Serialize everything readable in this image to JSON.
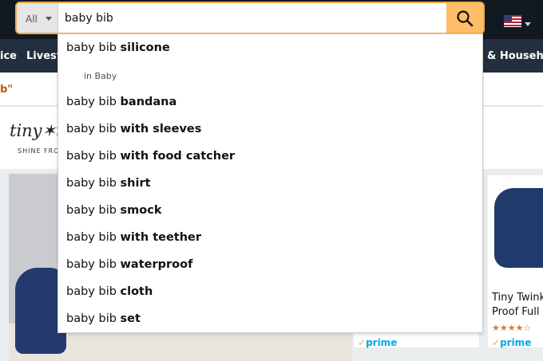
{
  "search": {
    "department": "All",
    "query": "baby bib"
  },
  "nav": {
    "items": [
      "ice",
      "Livestr",
      "& Househo"
    ]
  },
  "page": {
    "result_quote": "b\"",
    "brand_logo": "tiny✶t",
    "brand_tagline": "SHINE FROM",
    "cards": [
      {
        "title": "",
        "prime": "prime"
      },
      {
        "title": "Tiny Twink Proof Full",
        "stars": "★★★★☆",
        "prime": "prime"
      }
    ]
  },
  "suggestions": [
    {
      "prefix": "baby bib",
      "bold": "silicone",
      "sub": "in Baby"
    },
    {
      "prefix": "baby bib",
      "bold": "bandana"
    },
    {
      "prefix": "baby bib",
      "bold": "with sleeves"
    },
    {
      "prefix": "baby bib",
      "bold": "with food catcher"
    },
    {
      "prefix": "baby bib",
      "bold": "shirt"
    },
    {
      "prefix": "baby bib",
      "bold": "smock"
    },
    {
      "prefix": "baby bib",
      "bold": "with teether"
    },
    {
      "prefix": "baby bib",
      "bold": "waterproof"
    },
    {
      "prefix": "baby bib",
      "bold": "cloth"
    },
    {
      "prefix": "baby bib",
      "bold": "set"
    }
  ],
  "colors": {
    "header": "#131921",
    "nav": "#232f3e",
    "search_border": "#f3a847",
    "search_button": "#febd69",
    "prime": "#00a8e1"
  },
  "icons": [
    "search-icon",
    "us-flag-icon",
    "caret-down-icon",
    "prime-check-icon"
  ]
}
